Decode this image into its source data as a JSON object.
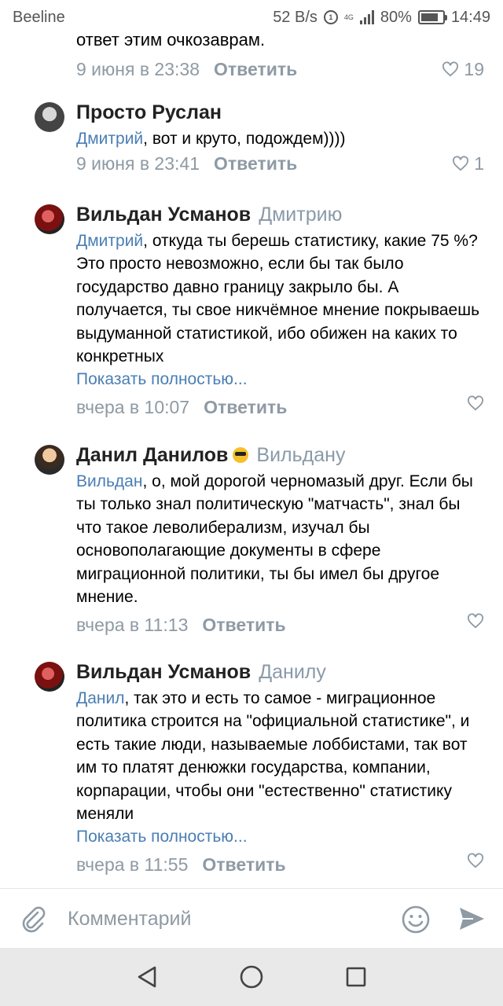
{
  "status_bar": {
    "carrier": "Beeline",
    "speed": "52 B/s",
    "network_badge": "1",
    "net_type": "4G",
    "battery": "80%",
    "battery_level": 0.8,
    "time": "14:49"
  },
  "comments": [
    {
      "text_tail": "ответ этим очкозаврам.",
      "date": "9 июня в 23:38",
      "reply_label": "Ответить",
      "likes": "19"
    },
    {
      "author": "Просто Руслан",
      "mention": "Дмитрий",
      "text": ", вот и круто, подождем))))",
      "date": "9 июня в 23:41",
      "reply_label": "Ответить",
      "likes": "1"
    },
    {
      "author": "Вильдан Усманов",
      "reply_to": "Дмитрию",
      "mention": "Дмитрий",
      "text": ", откуда ты берешь статистику, какие 75 %? Это просто невозможно, если бы так было государство давно границу закрыло бы. А получается, ты свое никчёмное мнение покрываешь выдуманной статистикой, ибо обижен на каких то конкретных",
      "show_more": "Показать полностью...",
      "date": "вчера в 10:07",
      "reply_label": "Ответить"
    },
    {
      "author": "Данил Данилов",
      "emoji": "smiling-face-with-sunglasses",
      "reply_to": "Вильдану",
      "mention": "Вильдан",
      "text": ", о, мой дорогой черномазый друг. Если бы ты только знал политическую \"матчасть\", знал бы что такое леволиберализм, изучал бы основополагающие документы в сфере миграционной политики, ты бы имел бы другое мнение.",
      "date": "вчера в 11:13",
      "reply_label": "Ответить"
    },
    {
      "author": "Вильдан Усманов",
      "reply_to": "Данилу",
      "mention": "Данил",
      "text": ", так это и есть то самое - миграционное политика строится на \"официальной статистике\", и есть такие люди, называемые лоббистами, так вот им то платят денюжки государства, компании, корпарации, чтобы они \"естественно\" статистику меняли",
      "show_more": "Показать полностью...",
      "date": "вчера в 11:55",
      "reply_label": "Ответить"
    }
  ],
  "composer": {
    "placeholder": "Комментарий",
    "icons": [
      "paperclip-icon",
      "smile-icon",
      "send-icon"
    ]
  },
  "navigation": {
    "icons": [
      "back-icon",
      "home-icon",
      "recents-icon"
    ]
  },
  "colors": {
    "link": "#4a7eb5",
    "meta": "#8e9aa4",
    "nav_bg": "#e9e9e9"
  }
}
